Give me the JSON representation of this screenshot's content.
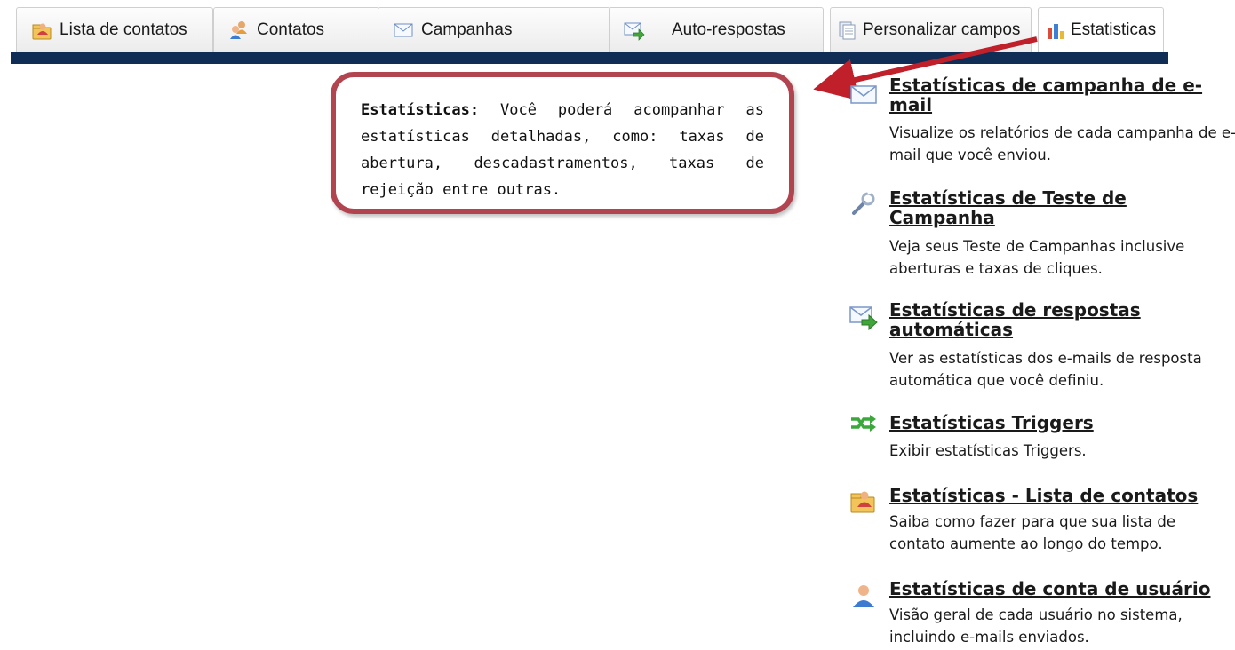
{
  "tabs": [
    {
      "label": "Lista de contatos",
      "icon": "contact-list-icon"
    },
    {
      "label": "Contatos",
      "icon": "contacts-icon"
    },
    {
      "label": "Campanhas",
      "icon": "envelope-icon"
    },
    {
      "label": "Auto-respostas",
      "icon": "auto-reply-icon"
    },
    {
      "label": "Personalizar campos",
      "icon": "custom-fields-icon"
    },
    {
      "label": "Estatisticas",
      "icon": "bar-chart-icon"
    }
  ],
  "callout": {
    "heading": "Estatísticas:",
    "body": " Você poderá acompanhar as estatísticas detalhadas, como: taxas de abertura, descadastramentos, taxas de rejeição entre outras."
  },
  "stats": [
    {
      "title": "Estatísticas de campanha de e-mail",
      "desc": "Visualize os relatórios de cada campanha de e-mail que você enviou.",
      "icon": "envelope-icon"
    },
    {
      "title": "Estatísticas de Teste de Campanha",
      "desc": "Veja seus Teste de Campanhas inclusive aberturas e taxas de cliques.",
      "icon": "wrench-icon"
    },
    {
      "title": "Estatísticas de respostas automáticas",
      "desc": "Ver as estatísticas dos e-mails de resposta automática que você definiu.",
      "icon": "auto-reply-icon"
    },
    {
      "title": "Estatísticas Triggers",
      "desc": "Exibir estatísticas Triggers.",
      "icon": "triggers-icon"
    },
    {
      "title": "Estatísticas - Lista de contatos",
      "desc": "Saiba como fazer para que sua lista de contato aumente ao longo do tempo.",
      "icon": "contact-list-icon"
    },
    {
      "title": "Estatísticas de conta de usuário",
      "desc": "Visão geral de cada usuário no sistema, incluindo e-mails enviados.",
      "icon": "user-icon"
    }
  ],
  "colors": {
    "nav_bar": "#0f2d55",
    "callout_border": "#b24450",
    "arrow": "#c0202a"
  }
}
